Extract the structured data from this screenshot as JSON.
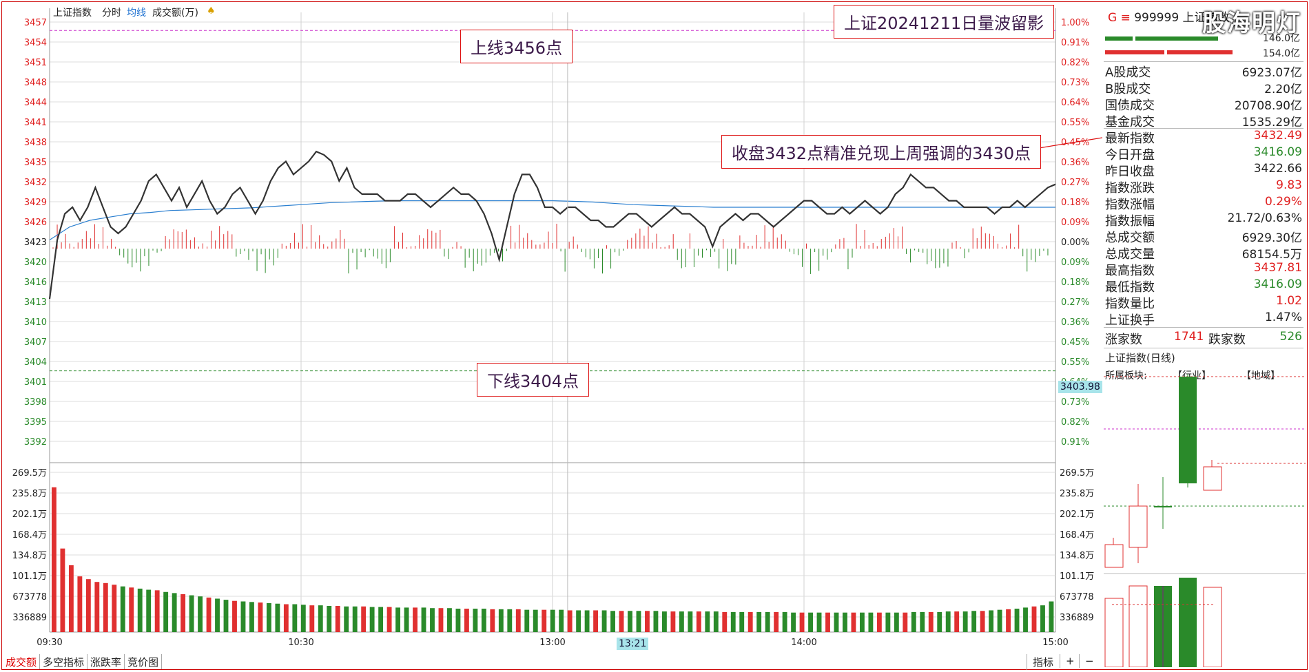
{
  "header": {
    "title": "上证指数",
    "tab_fenshi": "分时",
    "tab_junxian": "均线",
    "tab_volume": "成交额(万)"
  },
  "callouts": {
    "top_right": "上证20241211日量波留影",
    "upper_line": "上线3456点",
    "lower_line": "下线3404点",
    "close_note": "收盘3432点精准兑现上周强调的3430点"
  },
  "axes": {
    "price_ticks": [
      "3457",
      "3454",
      "3451",
      "3448",
      "3444",
      "3441",
      "3438",
      "3435",
      "3432",
      "3429",
      "3426",
      "3423",
      "3420",
      "3416",
      "3413",
      "3410",
      "3407",
      "3404",
      "3401",
      "3398",
      "3395",
      "3392"
    ],
    "pct_ticks": [
      "1.00%",
      "0.91%",
      "0.82%",
      "0.73%",
      "0.64%",
      "0.55%",
      "0.45%",
      "0.36%",
      "0.27%",
      "0.18%",
      "0.09%",
      "0.00%",
      "0.09%",
      "0.18%",
      "0.27%",
      "0.36%",
      "0.45%",
      "0.55%",
      "0.64%",
      "0.73%",
      "0.82%",
      "0.91%"
    ],
    "vol_ticks": [
      "269.5万",
      "235.8万",
      "202.1万",
      "168.4万",
      "134.8万",
      "101.1万",
      "673778",
      "336889"
    ],
    "time_ticks": [
      "09:30",
      "10:30",
      "13:00",
      "14:00",
      "15:00"
    ],
    "cursor_time": "13:21",
    "cursor_price": "3403.98"
  },
  "tabs": [
    "成交额",
    "多空指标",
    "涨跌率",
    "竞价图"
  ],
  "buttons": {
    "indicator": "指标",
    "plus": "+",
    "minus": "−"
  },
  "right_panel": {
    "code_prefix": "G  ≡",
    "code": "999999 上证指数",
    "top_val1": "146.0亿",
    "top_val2": "154.0亿",
    "rows": [
      {
        "label": "A股成交",
        "value": "6923.07亿",
        "color": "#222"
      },
      {
        "label": "B股成交",
        "value": "2.20亿",
        "color": "#222"
      },
      {
        "label": "国债成交",
        "value": "20708.90亿",
        "color": "#222"
      },
      {
        "label": "基金成交",
        "value": "1535.29亿",
        "color": "#222"
      },
      {
        "label": "最新指数",
        "value": "3432.49",
        "color": "#e02020"
      },
      {
        "label": "今日开盘",
        "value": "3416.09",
        "color": "#2a8a2a"
      },
      {
        "label": "昨日收盘",
        "value": "3422.66",
        "color": "#222"
      },
      {
        "label": "指数涨跌",
        "value": "9.83",
        "color": "#e02020"
      },
      {
        "label": "指数涨幅",
        "value": "0.29%",
        "color": "#e02020"
      },
      {
        "label": "指数振幅",
        "value": "21.72/0.63%",
        "color": "#222"
      },
      {
        "label": "总成交额",
        "value": "6929.30亿",
        "color": "#222"
      },
      {
        "label": "总成交量",
        "value": "68154.5万",
        "color": "#222"
      },
      {
        "label": "最高指数",
        "value": "3437.81",
        "color": "#e02020"
      },
      {
        "label": "最低指数",
        "value": "3416.09",
        "color": "#2a8a2a"
      },
      {
        "label": "指数量比",
        "value": "1.02",
        "color": "#e02020"
      },
      {
        "label": "上证换手",
        "value": "1.47%",
        "color": "#222"
      }
    ],
    "up_label": "涨家数",
    "up_count": "1741",
    "down_label": "跌家数",
    "down_count": "526",
    "daily_title": "上证指数(日线)",
    "sector_label": "所属板块:",
    "industry_label": "【行业】",
    "region_label": "【地域】"
  },
  "watermark": "股海明灯",
  "chart_data": {
    "type": "line",
    "prev_close": 3422.66,
    "ylim": [
      3390.5,
      3457.5
    ],
    "upper_line": 3456,
    "lower_line": 3404,
    "price_series": [
      3415,
      3424,
      3428,
      3429,
      3427,
      3429,
      3432,
      3429,
      3426,
      3425,
      3426,
      3428,
      3430,
      3433,
      3434,
      3432,
      3430,
      3432,
      3429,
      3431,
      3433,
      3430,
      3428,
      3429,
      3431,
      3432,
      3430,
      3428,
      3430,
      3433,
      3435,
      3436,
      3434,
      3435,
      3436,
      3437.5,
      3437,
      3436,
      3433,
      3435,
      3432,
      3431,
      3431,
      3431,
      3430,
      3430,
      3430,
      3431,
      3431,
      3430,
      3429,
      3430,
      3431,
      3432,
      3431,
      3431,
      3430,
      3428,
      3425,
      3421,
      3426,
      3431,
      3434,
      3434,
      3432,
      3429,
      3429,
      3428,
      3429,
      3429,
      3428,
      3427,
      3427,
      3426,
      3426,
      3427,
      3428,
      3428,
      3427,
      3426,
      3427,
      3428,
      3429,
      3428,
      3428,
      3427,
      3426,
      3423,
      3426,
      3427,
      3428,
      3427,
      3428,
      3428,
      3427,
      3426,
      3427,
      3428,
      3429,
      3430,
      3430,
      3429,
      3428,
      3428,
      3429,
      3428,
      3429,
      3430,
      3429,
      3428,
      3429,
      3431,
      3432,
      3434,
      3433,
      3432,
      3432,
      3431,
      3430,
      3430,
      3429,
      3429,
      3429,
      3429,
      3428,
      3429,
      3429,
      3430,
      3429,
      3430,
      3431,
      3432,
      3432.5
    ],
    "avg_series": [
      3424,
      3426,
      3427,
      3427.5,
      3428,
      3428.2,
      3428.5,
      3428.6,
      3428.7,
      3428.8,
      3428.9,
      3429.1,
      3429.3,
      3429.5,
      3429.7,
      3429.8,
      3429.9,
      3430,
      3430,
      3430,
      3430,
      3430,
      3430,
      3430,
      3430,
      3430,
      3429.9,
      3429.8,
      3429.6,
      3429.4,
      3429.3,
      3429.2,
      3429.1,
      3429,
      3429,
      3429,
      3429,
      3429,
      3429,
      3429,
      3429,
      3429,
      3429,
      3429,
      3429,
      3429,
      3429,
      3429,
      3429,
      3429,
      3429
    ],
    "volume_series": [
      260,
      150,
      120,
      100,
      95,
      90,
      88,
      85,
      82,
      80,
      78,
      76,
      75,
      72,
      70,
      68,
      66,
      64,
      62,
      60,
      58,
      56,
      55,
      54,
      53,
      52,
      51,
      50,
      50,
      49,
      48,
      48,
      47,
      47,
      46,
      46,
      46,
      45,
      45,
      45,
      44,
      44,
      44,
      44,
      43,
      43,
      43,
      42,
      42,
      42,
      42,
      41,
      41,
      41,
      41,
      40,
      40,
      40,
      40,
      40,
      39,
      39,
      39,
      39,
      39,
      38,
      38,
      38,
      38,
      38,
      38,
      37,
      37,
      37,
      37,
      37,
      37,
      37,
      36,
      36,
      36,
      36,
      36,
      36,
      36,
      36,
      35,
      35,
      35,
      35,
      35,
      35,
      35,
      35,
      35,
      35,
      35,
      35,
      35,
      35,
      36,
      36,
      36,
      36,
      37,
      37,
      37,
      38,
      38,
      39,
      40,
      41,
      42,
      44,
      46,
      48,
      55
    ],
    "vol_max": 269.5
  }
}
